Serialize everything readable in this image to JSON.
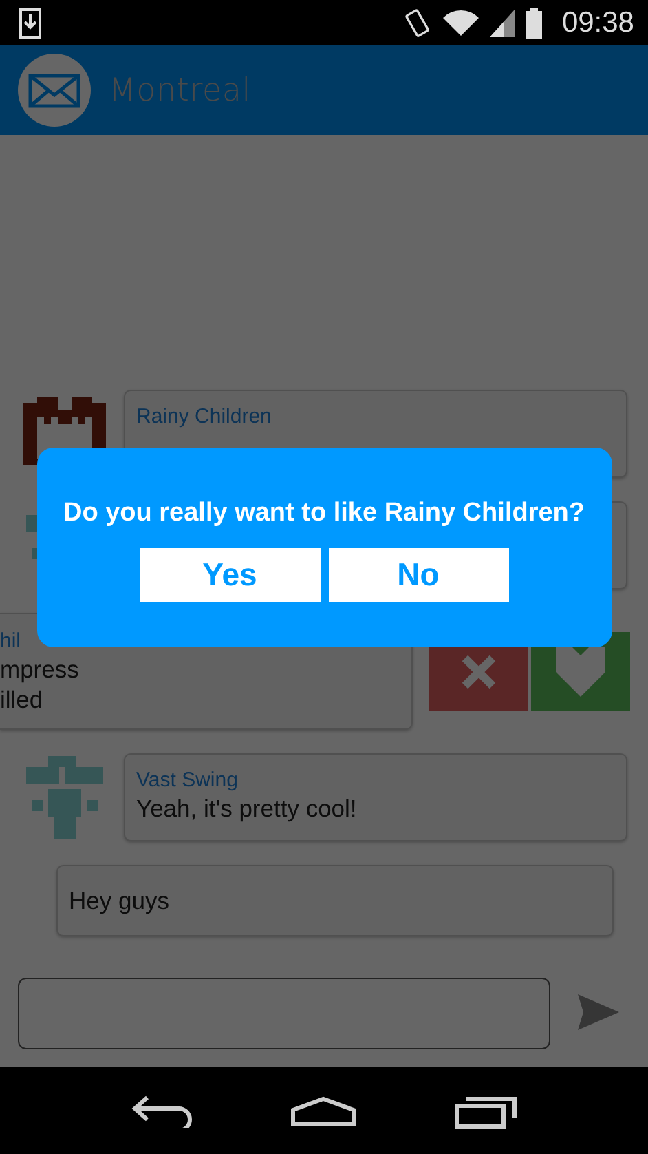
{
  "status_bar": {
    "time": "09:38"
  },
  "app_bar": {
    "title": "Montreal"
  },
  "messages": [
    {
      "kind": "incoming",
      "author": "Rainy Children",
      "avatar": {
        "kind": "castle"
      }
    },
    {
      "kind": "incoming",
      "avatar": {
        "kind": "figure"
      }
    },
    {
      "kind": "swiped",
      "author": "hil",
      "lines": [
        "mpress",
        "illed"
      ]
    },
    {
      "kind": "incoming",
      "author": "Vast Swing",
      "lines": [
        "Yeah, it's pretty cool!"
      ],
      "avatar": {
        "kind": "figure"
      }
    },
    {
      "kind": "outgoing",
      "lines": [
        "Hey guys"
      ]
    }
  ],
  "dialog": {
    "question": "Do you really want to like Rainy Children?",
    "buttons": [
      "Yes",
      "No"
    ]
  }
}
